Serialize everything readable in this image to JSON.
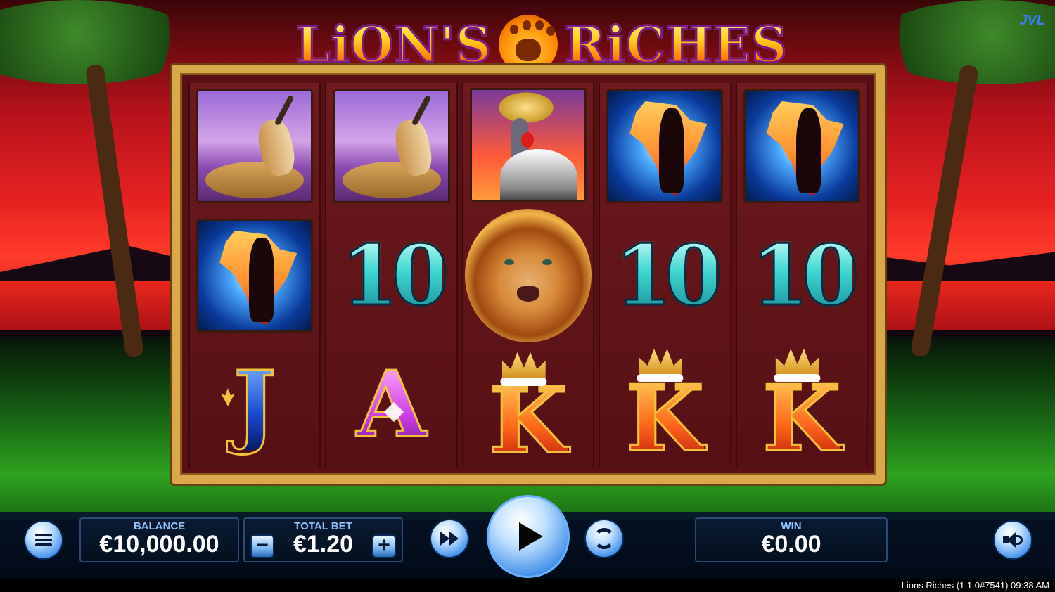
{
  "game": {
    "title_left": "LiON'S",
    "title_right": "RiCHES",
    "brand": "JVL"
  },
  "reels": [
    [
      "gazelle",
      "africa",
      "J"
    ],
    [
      "gazelle",
      "10",
      "A"
    ],
    [
      "crane",
      "lion",
      "K"
    ],
    [
      "africa",
      "10",
      "K"
    ],
    [
      "africa",
      "10",
      "K"
    ]
  ],
  "symbol_text": {
    "ten": "10",
    "j": "J",
    "a": "A",
    "k": "K"
  },
  "controls": {
    "balance_label": "BALANCE",
    "balance_value": "€10,000.00",
    "bet_label": "TOTAL BET",
    "bet_value": "€1.20",
    "bet_minus": "−",
    "bet_plus": "+",
    "win_label": "WIN",
    "win_value": "€0.00"
  },
  "icons": {
    "menu": "menu-icon",
    "turbo": "fast-forward-icon",
    "spin": "play-icon",
    "autoplay": "autoplay-cycle-icon",
    "sound": "speaker-icon"
  },
  "footer": {
    "version_text": "Lions Riches (1.1.0#7541) 09:38 AM"
  }
}
